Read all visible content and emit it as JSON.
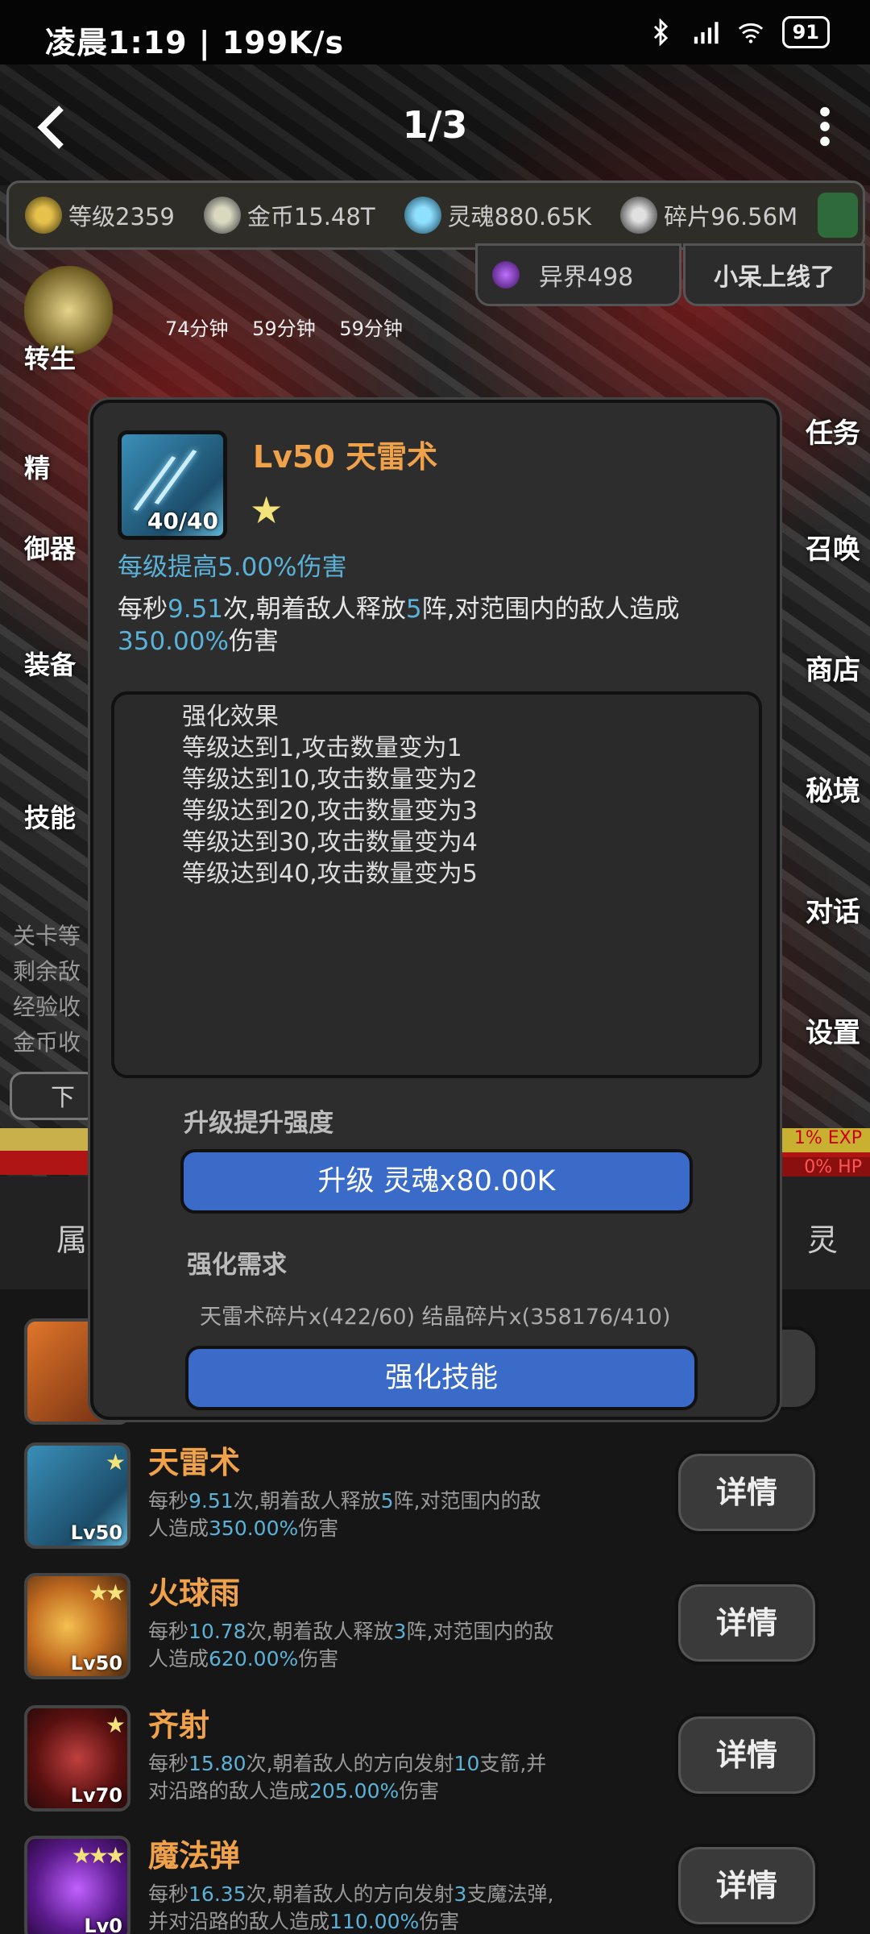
{
  "status_bar": {
    "time": "凌晨1:19 | 199K/s",
    "battery": "91"
  },
  "nav": {
    "page_indicator": "1/3"
  },
  "resources": {
    "level": "等级2359",
    "gold": "金币15.48T",
    "soul": "灵魂880.65K",
    "fragments": "碎片96.56M",
    "realm": "异界498",
    "online_notice": "小呆上线了"
  },
  "timers": "74分钟 59分钟 59分钟",
  "side_menu_left": [
    "转生",
    "精",
    "御器",
    "装备",
    "技能"
  ],
  "side_menu_right": [
    "任务",
    "召唤",
    "商店",
    "秘境",
    "对话",
    "设置"
  ],
  "stage_stats": [
    "关卡等",
    "剩余敌",
    "经验收",
    "金币收"
  ],
  "next_button": "下一",
  "bars": {
    "exp": "1% EXP",
    "hp": "0% HP"
  },
  "tabs": {
    "left": "属",
    "right": "灵"
  },
  "modal": {
    "title": "Lv50 天雷术",
    "icon_count": "40/40",
    "star": "★",
    "per_level": "每级提高5.00%伤害",
    "desc_parts": [
      "每秒",
      "9.51",
      "次,朝着敌人释放",
      "5",
      "阵,对范围内的敌人造成",
      "350.00%",
      "伤害"
    ],
    "enhance_effects": [
      "强化效果",
      "等级达到1,攻击数量变为1",
      "等级达到10,攻击数量变为2",
      "等级达到20,攻击数量变为3",
      "等级达到30,攻击数量变为4",
      "等级达到40,攻击数量变为5"
    ],
    "upgrade_label": "升级提升强度",
    "upgrade_button": "升级 灵魂x80.00K",
    "requirement_label": "强化需求",
    "requirement_text": "天雷术碎片x(422/60) 结晶碎片x(358176/410)",
    "enhance_button": "强化技能"
  },
  "skills": [
    {
      "name": "天雷术",
      "level": "Lv50",
      "stars": "★",
      "desc": [
        "每秒",
        "9.51",
        "次,朝着敌人释放",
        "5",
        "阵,对范围内的敌",
        "人造成",
        "350.00%",
        "伤害"
      ],
      "button": "详情"
    },
    {
      "name": "火球雨",
      "level": "Lv50",
      "stars": "★★",
      "desc": [
        "每秒",
        "10.78",
        "次,朝着敌人释放",
        "3",
        "阵,对范围内的敌",
        "人造成",
        "620.00%",
        "伤害"
      ],
      "button": "详情"
    },
    {
      "name": "齐射",
      "level": "Lv70",
      "stars": "★",
      "desc": [
        "每秒",
        "15.80",
        "次,朝着敌人的方向发射",
        "10",
        "支箭,并",
        "对沿路的敌人造成",
        "205.00%",
        "伤害"
      ],
      "button": "详情"
    },
    {
      "name": "魔法弹",
      "level": "Lv0",
      "stars": "★★★",
      "desc": [
        "每秒",
        "16.35",
        "次,朝着敌人的方向发射",
        "3",
        "支魔法弹,",
        "并对沿路的敌人造成",
        "110.00%",
        "伤害"
      ],
      "button": "详情"
    }
  ],
  "colors": {
    "accent_orange": "#f0a24a",
    "highlight_blue": "#5ab2d8",
    "button_blue": "#3b6bc9"
  }
}
